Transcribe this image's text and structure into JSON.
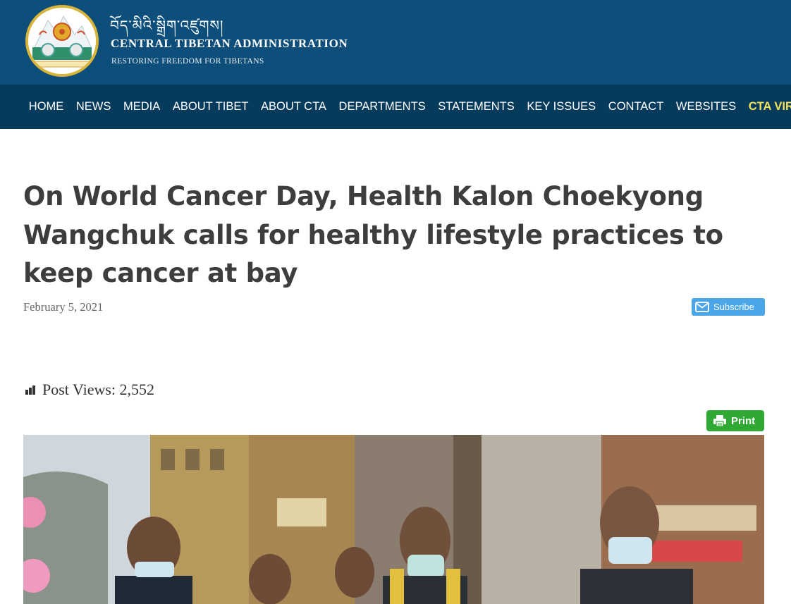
{
  "header": {
    "tibetan_title": "བོད་མིའི་སྒྲིག་འཛུགས།",
    "org_name": "CENTRAL TIBETAN ADMINISTRATION",
    "tagline": "RESTORING FREEDOM FOR TIBETANS",
    "logo_icon": "snow-lion-emblem-icon"
  },
  "nav": {
    "items": [
      "HOME",
      "NEWS",
      "MEDIA",
      "ABOUT TIBET",
      "ABOUT CTA",
      "DEPARTMENTS",
      "STATEMENTS",
      "KEY ISSUES",
      "CONTACT",
      "WEBSITES",
      "CTA VIRT"
    ]
  },
  "article": {
    "title": "On World Cancer Day, Health Kalon Choekyong Wangchuk calls for healthy lifestyle practices to keep cancer at bay",
    "date": "February 5, 2021",
    "subscribe_label": "Subscribe",
    "views_label": "Post Views:",
    "views_count": "2,552",
    "print_label": "Print"
  },
  "colors": {
    "header_bg": "#0d4f7a",
    "nav_bg": "#073b5c",
    "nav_highlight": "#f5e35a",
    "subscribe_bg": "#4aa6e8",
    "print_bg": "#2fa933",
    "title_text": "#3d3d3d"
  }
}
